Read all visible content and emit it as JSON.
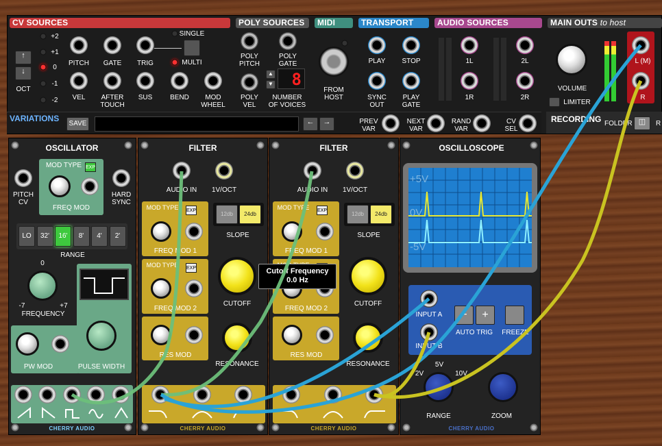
{
  "sections": {
    "cv_sources": "CV SOURCES",
    "poly_sources": "POLY SOURCES",
    "midi": "MIDI",
    "transport": "TRANSPORT",
    "audio_sources": "AUDIO SOURCES",
    "main_outs": "MAIN OUTS",
    "main_outs_suffix": "to host"
  },
  "cv": {
    "oct_values": [
      "+2",
      "+1",
      "0",
      "-1",
      "-2"
    ],
    "oct_label": "OCT",
    "pitch": "PITCH",
    "gate": "GATE",
    "trig": "TRIG",
    "single": "SINGLE",
    "multi": "MULTI",
    "vel": "VEL",
    "after_touch": "AFTER\nTOUCH",
    "sus": "SUS",
    "bend": "BEND",
    "mod_wheel": "MOD\nWHEEL"
  },
  "poly": {
    "poly_pitch": "POLY\nPITCH",
    "poly_gate": "POLY\nGATE",
    "poly_vel": "POLY\nVEL",
    "num_voices": "NUMBER\nOF VOICES",
    "voices_value": "8"
  },
  "midi": {
    "from_host": "FROM\nHOST"
  },
  "transport": {
    "play": "PLAY",
    "stop": "STOP",
    "sync_out": "SYNC\nOUT",
    "play_gate": "PLAY\nGATE"
  },
  "audio": {
    "l1": "1L",
    "l2": "2L",
    "r1": "1R",
    "r2": "2R"
  },
  "outs": {
    "volume": "VOLUME",
    "limiter": "LIMITER",
    "l_mono": "L (M)",
    "r": "R"
  },
  "variations": {
    "title": "VARIATIONS",
    "save": "SAVE",
    "prev": "PREV\nVAR",
    "next": "NEXT\nVAR",
    "rand": "RAND\nVAR",
    "cv_sel": "CV\nSEL"
  },
  "recording": {
    "title": "RECORDING",
    "folder": "FOLDER",
    "r": "R"
  },
  "oscillator": {
    "title": "OSCILLATOR",
    "mod_type": "MOD TYPE",
    "exp": "EXP",
    "pitch_cv": "PITCH\nCV",
    "freq_mod": "FREQ MOD",
    "hard_sync": "HARD\nSYNC",
    "ranges": [
      "LO",
      "32'",
      "16'",
      "8'",
      "4'",
      "2'"
    ],
    "range": "RANGE",
    "zero": "0",
    "minus7": "-7",
    "plus7": "+7",
    "frequency": "FREQUENCY",
    "pw_mod": "PW MOD",
    "pulse_width": "PULSE WIDTH",
    "brand": "CHERRY AUDIO"
  },
  "filter1": {
    "title": "FILTER",
    "audio_in": "AUDIO IN",
    "v_oct": "1V/OCT",
    "mod_type": "MOD TYPE",
    "exp": "EXP",
    "freq_mod1": "FREQ MOD 1",
    "freq_mod2": "FREQ MOD 2",
    "res_mod": "RES MOD",
    "slope": "SLOPE",
    "s12": "12db",
    "s24": "24db",
    "cutoff": "CUTOFF",
    "resonance": "RESONANCE",
    "brand": "CHERRY AUDIO"
  },
  "filter2": {
    "title": "FILTER",
    "audio_in": "AUDIO IN",
    "v_oct": "1V/OCT",
    "mod_type": "MOD TYPE",
    "exp": "EXP",
    "freq_mod1": "FREQ MOD 1",
    "freq_mod2": "FREQ MOD 2",
    "res_mod": "RES MOD",
    "slope": "SLOPE",
    "s12": "12db",
    "s24": "24db",
    "cutoff": "CUTOFF",
    "resonance": "RESONANCE",
    "brand": "CHERRY AUDIO"
  },
  "tooltip": {
    "title": "Cutoff Frequency",
    "value": "0.0 Hz"
  },
  "scope": {
    "title": "OSCILLOSCOPE",
    "plus5": "+5V",
    "zero": "0V",
    "minus5": "-5V",
    "input_a": "INPUT A",
    "input_b": "INPUT B",
    "auto_trig": "AUTO TRIG",
    "freeze": "FREEZE",
    "v2": "2V",
    "v5": "5V",
    "v10": "10V",
    "range": "RANGE",
    "zoom": "ZOOM",
    "brand": "CHERRY AUDIO"
  },
  "colors": {
    "cable_green": "#6dbf7a",
    "cable_blue": "#2aa3d6",
    "cable_yellow": "#c9c321",
    "scope_bg": "#1f7fd0",
    "yellow_trace": "#e8e832",
    "cyan_trace": "#8ff0ff"
  }
}
